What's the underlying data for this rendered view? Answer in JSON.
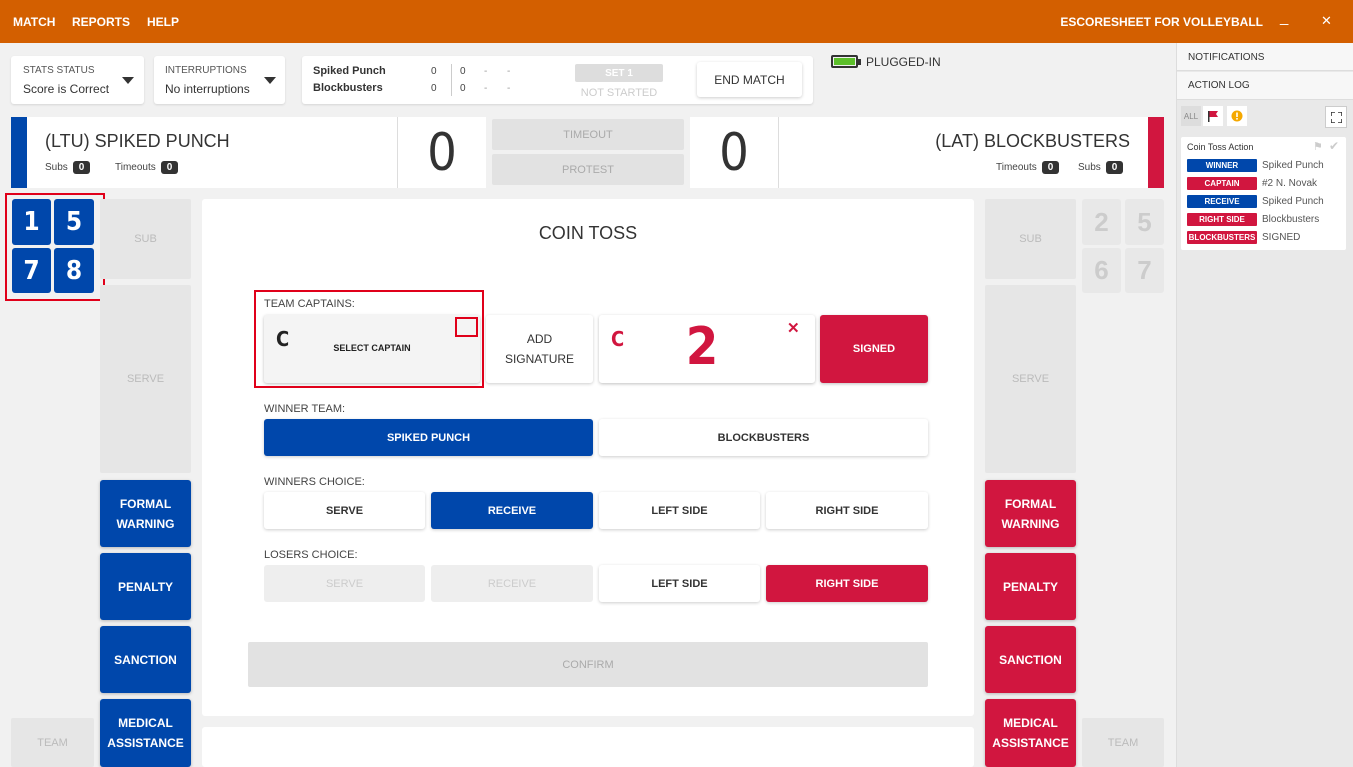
{
  "menu": {
    "match": "MATCH",
    "reports": "REPORTS",
    "help": "HELP"
  },
  "app_title": "ESCORESHEET FOR VOLLEYBALL",
  "window": {
    "minimize": "_",
    "close": "✕"
  },
  "stats_status": {
    "label": "STATS STATUS",
    "value": "Score is Correct"
  },
  "interruptions": {
    "label": "INTERRUPTIONS",
    "value": "No interruptions"
  },
  "scoreboard": {
    "rows": [
      {
        "team": "Spiked Punch",
        "sets": "0",
        "points": "0",
        "d1": "-",
        "d2": "-"
      },
      {
        "team": "Blockbusters",
        "sets": "0",
        "points": "0",
        "d1": "-",
        "d2": "-"
      }
    ],
    "set_label": "SET 1",
    "set_status": "NOT STARTED",
    "end_match": "END MATCH"
  },
  "battery": {
    "label": "PLUGGED-IN"
  },
  "home": {
    "name": "(LTU) SPIKED PUNCH",
    "score": "0",
    "subs_label": "Subs",
    "subs": "0",
    "timeouts_label": "Timeouts",
    "timeouts": "0",
    "color": "#0047ab"
  },
  "away": {
    "name": "(LAT) BLOCKBUSTERS",
    "score": "0",
    "subs_label": "Subs",
    "subs": "0",
    "timeouts_label": "Timeouts",
    "timeouts": "0",
    "color": "#d1163f"
  },
  "center_buttons": {
    "timeout": "TIMEOUT",
    "protest": "PROTEST"
  },
  "home_players": [
    "1",
    "5",
    "7",
    "8"
  ],
  "away_players": [
    "2",
    "5",
    "6",
    "7"
  ],
  "side": {
    "sub": "SUB",
    "serve": "SERVE",
    "team": "TEAM",
    "formal_warning": "FORMAL WARNING",
    "penalty": "PENALTY",
    "sanction": "SANCTION",
    "medical": "MEDICAL ASSISTANCE"
  },
  "coin_toss": {
    "title": "COIN TOSS",
    "captains_label": "TEAM CAPTAINS:",
    "captain_marker": "C",
    "select_captain": "SELECT CAPTAIN",
    "add_signature": "ADD SIGNATURE",
    "away_captain_number": "2",
    "remove_icon": "✕",
    "signed": "SIGNED",
    "winner_label": "WINNER TEAM:",
    "winner_options": [
      "SPIKED PUNCH",
      "BLOCKBUSTERS"
    ],
    "winners_choice_label": "WINNERS CHOICE:",
    "choices": [
      "SERVE",
      "RECEIVE",
      "LEFT SIDE",
      "RIGHT SIDE"
    ],
    "losers_choice_label": "LOSERS CHOICE:",
    "confirm": "CONFIRM"
  },
  "right_panel": {
    "notifications": "NOTIFICATIONS",
    "action_log": "ACTION LOG",
    "filter_all": "ALL",
    "log_title": "Coin Toss Action",
    "log": [
      {
        "tag": "WINNER",
        "value": "Spiked Punch",
        "color": "#0047ab"
      },
      {
        "tag": "CAPTAIN",
        "value": "#2 N. Novak",
        "color": "#d1163f"
      },
      {
        "tag": "RECEIVE",
        "value": "Spiked Punch",
        "color": "#0047ab"
      },
      {
        "tag": "RIGHT SIDE",
        "value": "Blockbusters",
        "color": "#d1163f"
      },
      {
        "tag": "BLOCKBUSTERS",
        "value": "SIGNED",
        "color": "#d1163f"
      }
    ]
  }
}
